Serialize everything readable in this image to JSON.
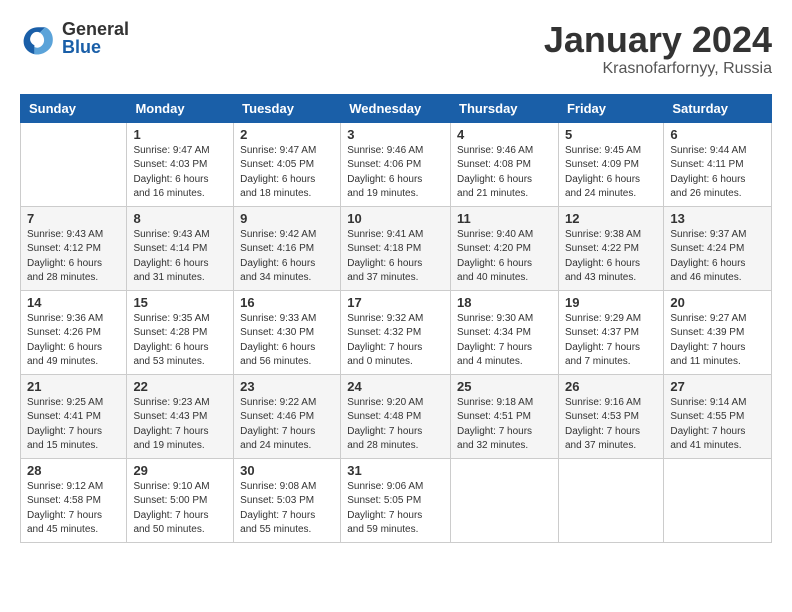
{
  "logo": {
    "general": "General",
    "blue": "Blue"
  },
  "title": {
    "month": "January 2024",
    "location": "Krasnofarfornyy, Russia"
  },
  "weekdays": [
    "Sunday",
    "Monday",
    "Tuesday",
    "Wednesday",
    "Thursday",
    "Friday",
    "Saturday"
  ],
  "weeks": [
    [
      {
        "day": null,
        "info": null
      },
      {
        "day": "1",
        "info": "Sunrise: 9:47 AM\nSunset: 4:03 PM\nDaylight: 6 hours\nand 16 minutes."
      },
      {
        "day": "2",
        "info": "Sunrise: 9:47 AM\nSunset: 4:05 PM\nDaylight: 6 hours\nand 18 minutes."
      },
      {
        "day": "3",
        "info": "Sunrise: 9:46 AM\nSunset: 4:06 PM\nDaylight: 6 hours\nand 19 minutes."
      },
      {
        "day": "4",
        "info": "Sunrise: 9:46 AM\nSunset: 4:08 PM\nDaylight: 6 hours\nand 21 minutes."
      },
      {
        "day": "5",
        "info": "Sunrise: 9:45 AM\nSunset: 4:09 PM\nDaylight: 6 hours\nand 24 minutes."
      },
      {
        "day": "6",
        "info": "Sunrise: 9:44 AM\nSunset: 4:11 PM\nDaylight: 6 hours\nand 26 minutes."
      }
    ],
    [
      {
        "day": "7",
        "info": "Sunrise: 9:43 AM\nSunset: 4:12 PM\nDaylight: 6 hours\nand 28 minutes."
      },
      {
        "day": "8",
        "info": "Sunrise: 9:43 AM\nSunset: 4:14 PM\nDaylight: 6 hours\nand 31 minutes."
      },
      {
        "day": "9",
        "info": "Sunrise: 9:42 AM\nSunset: 4:16 PM\nDaylight: 6 hours\nand 34 minutes."
      },
      {
        "day": "10",
        "info": "Sunrise: 9:41 AM\nSunset: 4:18 PM\nDaylight: 6 hours\nand 37 minutes."
      },
      {
        "day": "11",
        "info": "Sunrise: 9:40 AM\nSunset: 4:20 PM\nDaylight: 6 hours\nand 40 minutes."
      },
      {
        "day": "12",
        "info": "Sunrise: 9:38 AM\nSunset: 4:22 PM\nDaylight: 6 hours\nand 43 minutes."
      },
      {
        "day": "13",
        "info": "Sunrise: 9:37 AM\nSunset: 4:24 PM\nDaylight: 6 hours\nand 46 minutes."
      }
    ],
    [
      {
        "day": "14",
        "info": "Sunrise: 9:36 AM\nSunset: 4:26 PM\nDaylight: 6 hours\nand 49 minutes."
      },
      {
        "day": "15",
        "info": "Sunrise: 9:35 AM\nSunset: 4:28 PM\nDaylight: 6 hours\nand 53 minutes."
      },
      {
        "day": "16",
        "info": "Sunrise: 9:33 AM\nSunset: 4:30 PM\nDaylight: 6 hours\nand 56 minutes."
      },
      {
        "day": "17",
        "info": "Sunrise: 9:32 AM\nSunset: 4:32 PM\nDaylight: 7 hours\nand 0 minutes."
      },
      {
        "day": "18",
        "info": "Sunrise: 9:30 AM\nSunset: 4:34 PM\nDaylight: 7 hours\nand 4 minutes."
      },
      {
        "day": "19",
        "info": "Sunrise: 9:29 AM\nSunset: 4:37 PM\nDaylight: 7 hours\nand 7 minutes."
      },
      {
        "day": "20",
        "info": "Sunrise: 9:27 AM\nSunset: 4:39 PM\nDaylight: 7 hours\nand 11 minutes."
      }
    ],
    [
      {
        "day": "21",
        "info": "Sunrise: 9:25 AM\nSunset: 4:41 PM\nDaylight: 7 hours\nand 15 minutes."
      },
      {
        "day": "22",
        "info": "Sunrise: 9:23 AM\nSunset: 4:43 PM\nDaylight: 7 hours\nand 19 minutes."
      },
      {
        "day": "23",
        "info": "Sunrise: 9:22 AM\nSunset: 4:46 PM\nDaylight: 7 hours\nand 24 minutes."
      },
      {
        "day": "24",
        "info": "Sunrise: 9:20 AM\nSunset: 4:48 PM\nDaylight: 7 hours\nand 28 minutes."
      },
      {
        "day": "25",
        "info": "Sunrise: 9:18 AM\nSunset: 4:51 PM\nDaylight: 7 hours\nand 32 minutes."
      },
      {
        "day": "26",
        "info": "Sunrise: 9:16 AM\nSunset: 4:53 PM\nDaylight: 7 hours\nand 37 minutes."
      },
      {
        "day": "27",
        "info": "Sunrise: 9:14 AM\nSunset: 4:55 PM\nDaylight: 7 hours\nand 41 minutes."
      }
    ],
    [
      {
        "day": "28",
        "info": "Sunrise: 9:12 AM\nSunset: 4:58 PM\nDaylight: 7 hours\nand 45 minutes."
      },
      {
        "day": "29",
        "info": "Sunrise: 9:10 AM\nSunset: 5:00 PM\nDaylight: 7 hours\nand 50 minutes."
      },
      {
        "day": "30",
        "info": "Sunrise: 9:08 AM\nSunset: 5:03 PM\nDaylight: 7 hours\nand 55 minutes."
      },
      {
        "day": "31",
        "info": "Sunrise: 9:06 AM\nSunset: 5:05 PM\nDaylight: 7 hours\nand 59 minutes."
      },
      {
        "day": null,
        "info": null
      },
      {
        "day": null,
        "info": null
      },
      {
        "day": null,
        "info": null
      }
    ]
  ]
}
